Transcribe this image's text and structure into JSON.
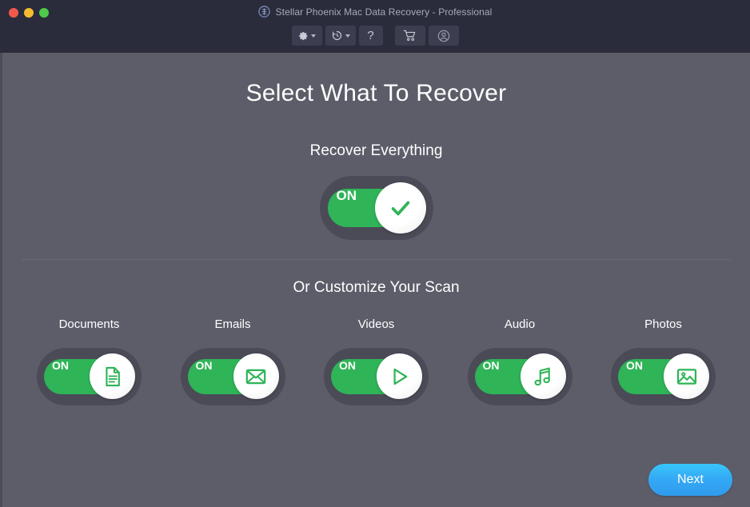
{
  "window": {
    "title": "Stellar Phoenix Mac Data Recovery - Professional",
    "logo_icon": "stellar-logo-icon",
    "traffic_lights": [
      {
        "name": "close",
        "color": "#f2594b"
      },
      {
        "name": "minimize",
        "color": "#f5bc2f"
      },
      {
        "name": "maximize",
        "color": "#4dc94c"
      }
    ]
  },
  "toolbar": {
    "buttons": [
      {
        "id": "settings",
        "icon": "gear-icon",
        "has_caret": true
      },
      {
        "id": "history",
        "icon": "clock-history-icon",
        "has_caret": true
      },
      {
        "id": "help",
        "icon": "question-mark-icon",
        "label": "?",
        "has_caret": false
      },
      {
        "id": "store",
        "icon": "shopping-cart-icon",
        "has_caret": false
      },
      {
        "id": "account",
        "icon": "user-account-icon",
        "has_caret": false
      }
    ]
  },
  "main": {
    "page_title": "Select What To Recover",
    "recover_everything": {
      "heading": "Recover Everything",
      "toggle_state": "ON",
      "on_label": "ON",
      "knob_icon": "checkmark-icon"
    },
    "customize": {
      "heading": "Or Customize Your Scan",
      "categories": [
        {
          "label": "Documents",
          "on_label": "ON",
          "state": "ON",
          "icon": "document-icon"
        },
        {
          "label": "Emails",
          "on_label": "ON",
          "state": "ON",
          "icon": "envelope-icon"
        },
        {
          "label": "Videos",
          "on_label": "ON",
          "state": "ON",
          "icon": "play-icon"
        },
        {
          "label": "Audio",
          "on_label": "ON",
          "state": "ON",
          "icon": "music-note-icon"
        },
        {
          "label": "Photos",
          "on_label": "ON",
          "state": "ON",
          "icon": "image-icon"
        }
      ]
    }
  },
  "footer": {
    "next_label": "Next"
  },
  "colors": {
    "titlebar_bg": "#2b2c3b",
    "content_bg": "#5c5d69",
    "toggle_track": "#4a4b57",
    "toggle_on_green": "#2fb457",
    "accent_blue": "#34a9f4",
    "icon_green": "#2fb457"
  }
}
